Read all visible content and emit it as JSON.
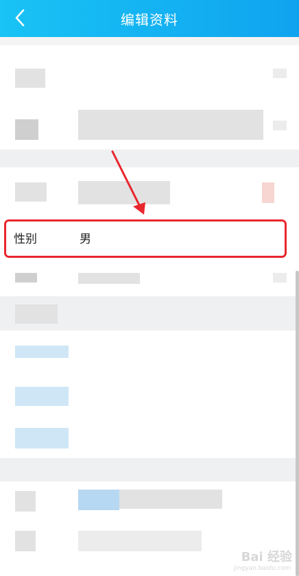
{
  "header": {
    "title": "编辑资料",
    "back_icon": "chevron-left-icon",
    "background": "#12b5f3"
  },
  "gender_row": {
    "label": "性别",
    "value": "男"
  },
  "annotation": {
    "color": "#e8262d"
  },
  "watermark": {
    "text": "Bai 经验",
    "subtext": "jingyan.baidu.com"
  }
}
